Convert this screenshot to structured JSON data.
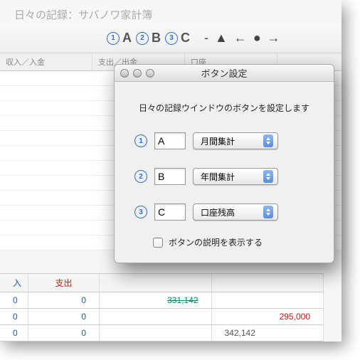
{
  "bg": {
    "title": "日々の記録：サバノワ家計簿",
    "toolbar": {
      "a": "A",
      "b": "B",
      "c": "C"
    },
    "cols": {
      "income": "収入／入金",
      "expense": "支出／出金",
      "account": "口座"
    },
    "footHead": {
      "income": "入",
      "expense": "支出"
    },
    "rows": [
      {
        "i": "0",
        "e": "0",
        "v1": "331,142",
        "v2": ""
      },
      {
        "i": "0",
        "e": "0",
        "v1": "",
        "v2": "295,000"
      },
      {
        "i": "0",
        "e": "0",
        "v1": "",
        "v2": "342,142"
      }
    ]
  },
  "dlg": {
    "title": "ボタン設定",
    "desc": "日々の記録ウインドウのボタンを設定します",
    "items": [
      {
        "n": "1",
        "ch": "A",
        "opt": "月間集計"
      },
      {
        "n": "2",
        "ch": "B",
        "opt": "年間集計"
      },
      {
        "n": "3",
        "ch": "C",
        "opt": "口座残高"
      }
    ],
    "check": "ボタンの説明を表示する"
  }
}
